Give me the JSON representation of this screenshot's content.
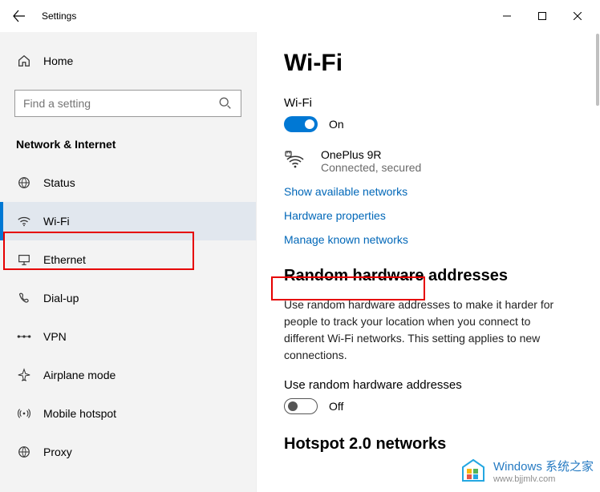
{
  "window": {
    "title": "Settings"
  },
  "sidebar": {
    "home_label": "Home",
    "search_placeholder": "Find a setting",
    "section": "Network & Internet",
    "items": [
      {
        "label": "Status"
      },
      {
        "label": "Wi-Fi"
      },
      {
        "label": "Ethernet"
      },
      {
        "label": "Dial-up"
      },
      {
        "label": "VPN"
      },
      {
        "label": "Airplane mode"
      },
      {
        "label": "Mobile hotspot"
      },
      {
        "label": "Proxy"
      }
    ]
  },
  "main": {
    "title": "Wi-Fi",
    "wifi_label": "Wi-Fi",
    "wifi_state": "On",
    "network": {
      "name": "OnePlus 9R",
      "status": "Connected, secured"
    },
    "links": {
      "show_networks": "Show available networks",
      "hardware_props": "Hardware properties",
      "manage_known": "Manage known networks"
    },
    "random_hw": {
      "title": "Random hardware addresses",
      "body": "Use random hardware addresses to make it harder for people to track your location when you connect to different Wi-Fi networks. This setting applies to new connections.",
      "toggle_label": "Use random hardware addresses",
      "state": "Off"
    },
    "hotspot": {
      "title": "Hotspot 2.0 networks"
    }
  },
  "watermark": {
    "line1": "Windows 系统之家",
    "line2": "www.bjjmlv.com"
  }
}
